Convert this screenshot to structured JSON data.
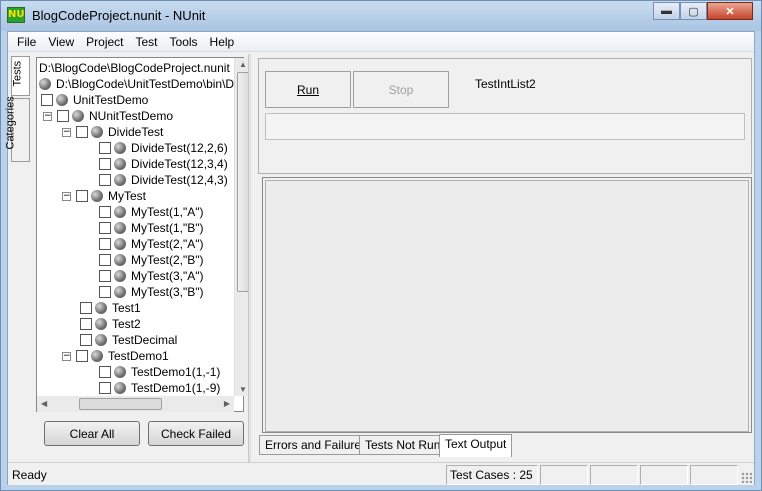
{
  "window": {
    "title": "BlogCodeProject.nunit - NUnit",
    "icon_text": "NU",
    "minimize_glyph": "▬",
    "maximize_glyph": "▢",
    "close_glyph": "✕"
  },
  "menu": [
    "File",
    "View",
    "Project",
    "Test",
    "Tools",
    "Help"
  ],
  "side_tabs": {
    "tests": "Tests",
    "categories": "Categories"
  },
  "tree": {
    "path": "D:\\BlogCode\\BlogCodeProject.nunit",
    "assembly": "D:\\BlogCode\\UnitTestDemo\\bin\\De",
    "nodes": [
      {
        "label": "UnitTestDemo"
      },
      {
        "label": "NUnitTestDemo"
      },
      {
        "label": "DivideTest"
      },
      {
        "label": "DivideTest(12,2,6)"
      },
      {
        "label": "DivideTest(12,3,4)"
      },
      {
        "label": "DivideTest(12,4,3)"
      },
      {
        "label": "MyTest"
      },
      {
        "label": "MyTest(1,\"A\")"
      },
      {
        "label": "MyTest(1,\"B\")"
      },
      {
        "label": "MyTest(2,\"A\")"
      },
      {
        "label": "MyTest(2,\"B\")"
      },
      {
        "label": "MyTest(3,\"A\")"
      },
      {
        "label": "MyTest(3,\"B\")"
      },
      {
        "label": "Test1"
      },
      {
        "label": "Test2"
      },
      {
        "label": "TestDecimal"
      },
      {
        "label": "TestDemo1"
      },
      {
        "label": "TestDemo1(1,-1)"
      },
      {
        "label": "TestDemo1(1,-9)"
      }
    ]
  },
  "buttons": {
    "clear_all": "Clear All",
    "check_failed": "Check Failed",
    "run": "Run",
    "stop": "Stop"
  },
  "run_panel": {
    "test_name": "TestIntList2"
  },
  "bottom_tabs": [
    "Errors and Failures",
    "Tests Not Run",
    "Text Output"
  ],
  "status": {
    "ready": "Ready",
    "test_cases": "Test Cases : 25"
  }
}
